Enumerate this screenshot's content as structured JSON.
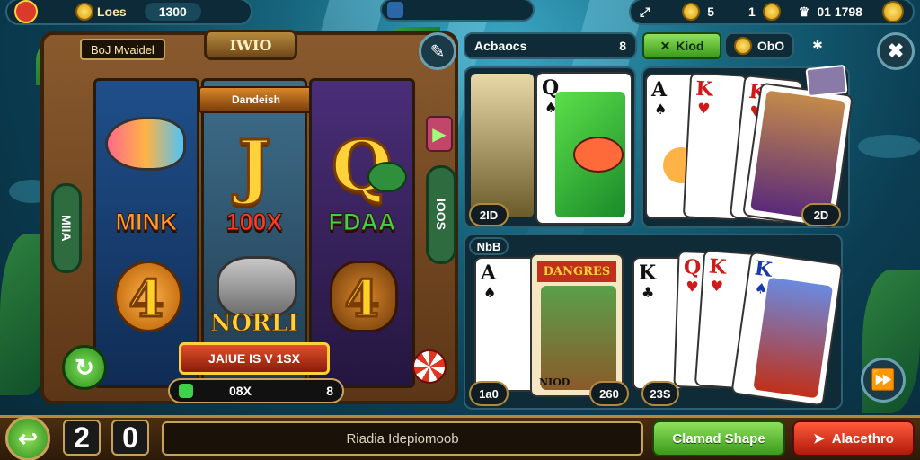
{
  "hud": {
    "logo_label": "Loes",
    "balance": "1300",
    "info_label": "",
    "count_value": "5",
    "bonus_value": "1",
    "score": "01 1798"
  },
  "slot": {
    "title_tag": "BoJ Mvaidel",
    "banner": "IWIO",
    "sub_banner": "Dandeish",
    "reel_letters": [
      "J",
      "Q"
    ],
    "row_labels": [
      "MINK",
      "100X",
      "FDAA"
    ],
    "bottom_numbers": [
      "4",
      "4"
    ],
    "center_label": "NORLI",
    "side_left": "MIIA",
    "side_right": "IOOS",
    "jackpot_label": "JAIUE IS V 1SX",
    "bet_display": "08X",
    "bet_count": "8"
  },
  "right_panel": {
    "player_name": "Acbaocs",
    "player_count": "8",
    "kiod_label": "Kiod",
    "coins_label": "ObO",
    "top_left_tag": "2ID",
    "top_right_tag": "2D",
    "section_label": "NbB",
    "bottom_tags": [
      "1a0",
      "260",
      "23S"
    ],
    "card_banner": "DANGRES",
    "card_subtitle": "NIOD",
    "cards_top": [
      {
        "rank": "Q",
        "suit": "♠"
      },
      {
        "rank": "A",
        "suit": "♠"
      },
      {
        "rank": "K",
        "suit": "♥"
      },
      {
        "rank": "K",
        "suit": "♥"
      }
    ],
    "cards_bottom": [
      {
        "rank": "A",
        "suit": "♠"
      },
      {
        "rank": "K",
        "suit": "♣"
      },
      {
        "rank": "Q",
        "suit": "♥"
      },
      {
        "rank": "K",
        "suit": "♥"
      },
      {
        "rank": "K",
        "suit": "♠"
      }
    ]
  },
  "bottom": {
    "digits": [
      "2",
      "0"
    ],
    "message": "Riadia Idepiomoob",
    "green_button": "Clamad Shape",
    "red_button": "Alacethro"
  },
  "colors": {
    "accent_green": "#5cc23a",
    "accent_red": "#e0361f",
    "gold": "#ffd23a"
  }
}
